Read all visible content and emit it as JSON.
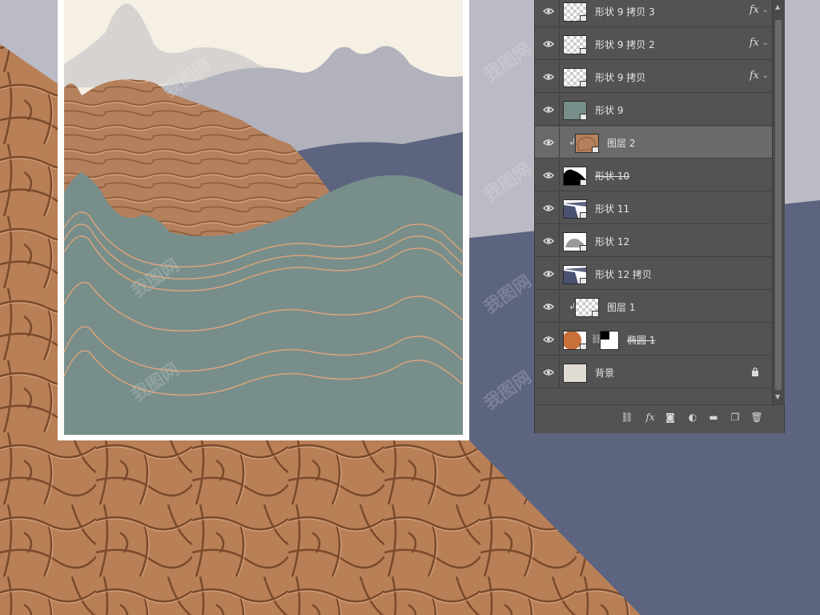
{
  "colors": {
    "slate_blue": "#5c6480",
    "cream": "#f5efe4",
    "copper": "#b98058",
    "teal": "#778e8a",
    "panel": "#535353",
    "selected_row": "#6a6a6a"
  },
  "layers": [
    {
      "name": "形状 9 拷贝 3",
      "thumb": "checker",
      "fx": "fx",
      "struck": false
    },
    {
      "name": "形状 9 拷贝 2",
      "thumb": "checker",
      "fx": "fx",
      "struck": false
    },
    {
      "name": "形状 9 拷贝",
      "thumb": "checker",
      "fx": "fx",
      "struck": false
    },
    {
      "name": "形状 9",
      "thumb": "teal",
      "fx": "",
      "struck": false
    },
    {
      "name": "图层 2",
      "thumb": "copper",
      "fx": "",
      "struck": false,
      "selected": true,
      "clipped": true
    },
    {
      "name": "形状 10",
      "thumb": "black",
      "fx": "",
      "struck": true
    },
    {
      "name": "形状 11",
      "thumb": "blue",
      "fx": "",
      "struck": false
    },
    {
      "name": "形状 12",
      "thumb": "gray",
      "fx": "",
      "struck": false
    },
    {
      "name": "形状 12 拷贝",
      "thumb": "blue",
      "fx": "",
      "struck": false
    },
    {
      "name": "图层 1",
      "thumb": "checker",
      "fx": "",
      "struck": false,
      "clipped": true
    },
    {
      "name": "椭圆 1",
      "thumb": "orange",
      "fx": "",
      "struck": true,
      "mask": true
    },
    {
      "name": "背景",
      "thumb": "beige",
      "fx": "",
      "struck": false,
      "locked": true
    }
  ],
  "icons": {
    "visibility": "eye-icon",
    "link": "link-icon",
    "fx": "fx",
    "mask": "mask-icon",
    "adjustment": "adjustment-icon",
    "group": "folder-icon",
    "new_layer": "new-layer-icon",
    "delete": "trash-icon",
    "lock": "lock-icon",
    "clip": "clip-arrow-icon",
    "smart_object": "smart-object-icon"
  },
  "watermark_text": "我图网"
}
